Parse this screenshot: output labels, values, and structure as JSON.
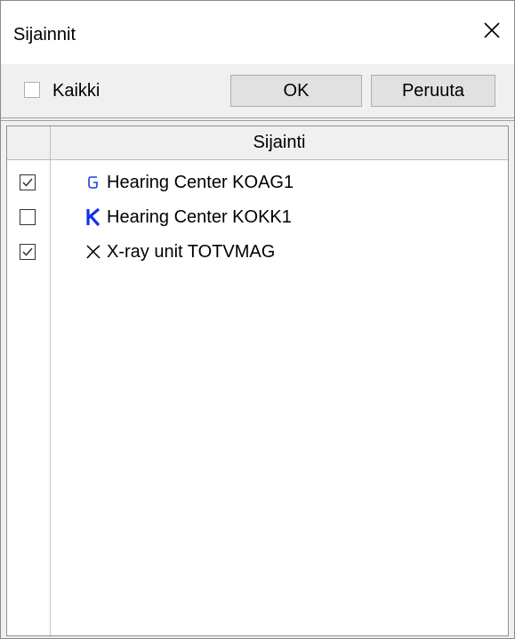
{
  "window": {
    "title": "Sijainnit"
  },
  "toolbar": {
    "all_label": "Kaikki",
    "all_checked": false,
    "ok_label": "OK",
    "cancel_label": "Peruuta"
  },
  "table": {
    "column_header": "Sijainti",
    "rows": [
      {
        "checked": true,
        "icon": "g-letter-icon",
        "icon_color": "#1a3fe0",
        "label": "Hearing Center KOAG1"
      },
      {
        "checked": false,
        "icon": "k-letter-icon",
        "icon_color": "#1432e6",
        "label": "Hearing Center KOKK1"
      },
      {
        "checked": true,
        "icon": "x-cross-icon",
        "icon_color": "#000000",
        "label": "X-ray unit TOTVMAG"
      }
    ]
  }
}
